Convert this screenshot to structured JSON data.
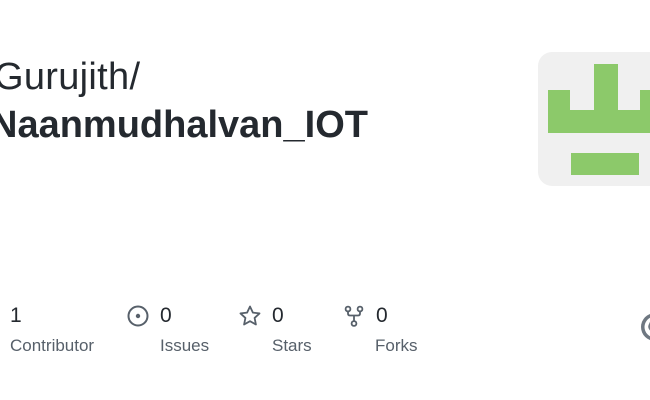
{
  "repo_card": {
    "owner": "Gurujith/",
    "name": "Naanmudhalvan_IOT",
    "avatar": {
      "icon": "identicon",
      "color": "#8cc96a",
      "background": "#f0f0f0"
    },
    "stats": [
      {
        "key": "contributors",
        "count": "1",
        "label": "Contributor",
        "icon": ""
      },
      {
        "key": "issues",
        "count": "0",
        "label": "Issues",
        "icon": "issue-opened-icon"
      },
      {
        "key": "stars",
        "count": "0",
        "label": "Stars",
        "icon": "star-icon"
      },
      {
        "key": "forks",
        "count": "0",
        "label": "Forks",
        "icon": "repo-forked-icon"
      }
    ],
    "brand_icon": "github-logo-icon",
    "colors": {
      "text_primary": "#24292f",
      "text_secondary": "#57606a",
      "icon": "#57606a",
      "logo": "#6e7781"
    }
  }
}
